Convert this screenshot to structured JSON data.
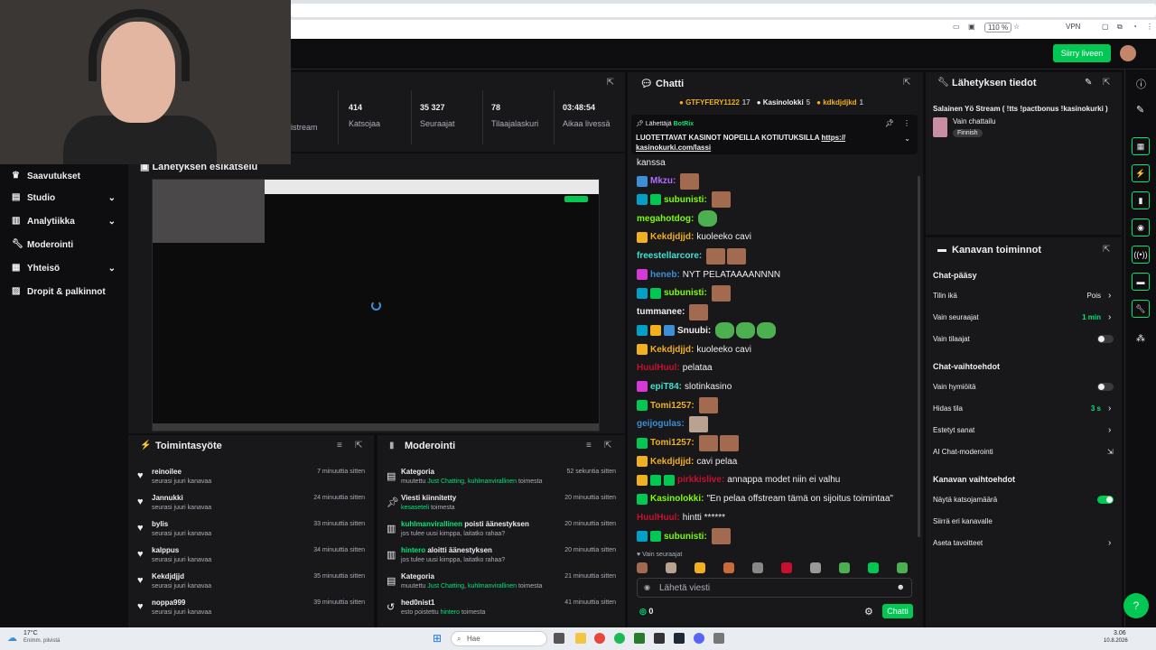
{
  "browser": {
    "zoom": "110 %",
    "vpn": "VPN"
  },
  "topbar": {
    "go_live": "Siirry liveen"
  },
  "nav": {
    "items": [
      {
        "label": "Saavutukset",
        "icon": "trophy-icon",
        "chev": false
      },
      {
        "label": "Studio",
        "icon": "studio-icon",
        "chev": true
      },
      {
        "label": "Analytiikka",
        "icon": "analytics-icon",
        "chev": true
      },
      {
        "label": "Moderointi",
        "icon": "wrench-icon",
        "chev": false
      },
      {
        "label": "Yhteisö",
        "icon": "community-icon",
        "chev": true
      },
      {
        "label": "Dropit & palkinnot",
        "icon": "gift-icon",
        "chev": false
      }
    ]
  },
  "stats": {
    "first_label": "istream",
    "items": [
      {
        "value": "414",
        "label": "Katsojaa"
      },
      {
        "value": "35 327",
        "label": "Seuraajat"
      },
      {
        "value": "78",
        "label": "Tilaajalaskuri"
      },
      {
        "value": "03:48:54",
        "label": "Aikaa livessä"
      }
    ]
  },
  "preview": {
    "title": "Lähetyksen esikatselu"
  },
  "activity": {
    "title": "Toimintasyöte",
    "items": [
      {
        "name": "reinoilee",
        "sub": "seurasi juuri kanavaa",
        "time": "7 minuuttia sitten"
      },
      {
        "name": "Jannukki",
        "sub": "seurasi juuri kanavaa",
        "time": "24 minuuttia sitten"
      },
      {
        "name": "bylis",
        "sub": "seurasi juuri kanavaa",
        "time": "33 minuuttia sitten"
      },
      {
        "name": "kalppus",
        "sub": "seurasi juuri kanavaa",
        "time": "34 minuuttia sitten"
      },
      {
        "name": "Kekdjdjjd",
        "sub": "seurasi juuri kanavaa",
        "time": "35 minuuttia sitten"
      },
      {
        "name": "noppa999",
        "sub": "seurasi juuri kanavaa",
        "time": "39 minuuttia sitten"
      }
    ]
  },
  "moderation": {
    "title": "Moderointi",
    "items": [
      {
        "name": "Kategoria",
        "pre": "muutettu ",
        "g1": "Just Chatting",
        "mid": ", ",
        "g2": "kuhlmanvirallinen",
        "post": " toimesta",
        "time": "52 sekuntia sitten",
        "icon": "category-icon"
      },
      {
        "name": "Viesti kiinnitetty",
        "pre": "",
        "g1": "kesaseteli",
        "mid": " toimesta",
        "g2": "",
        "post": "",
        "time": "20 minuuttia sitten",
        "icon": "pin-icon"
      },
      {
        "name_g": "kuhlmanvirallinen",
        "name": " poisti äänestyksen",
        "pre": "jos tulee uusi kimppa, laitatko rahaa?",
        "g1": "",
        "mid": "",
        "g2": "",
        "post": "",
        "time": "20 minuuttia sitten",
        "icon": "poll-icon"
      },
      {
        "name_g": "hintero",
        "name": " aloitti äänestyksen",
        "pre": "jos tulee uusi kimppa, laitatko rahaa?",
        "g1": "",
        "mid": "",
        "g2": "",
        "post": "",
        "time": "20 minuuttia sitten",
        "icon": "poll-icon"
      },
      {
        "name": "Kategoria",
        "pre": "muutettu ",
        "g1": "Just Chatting",
        "mid": ", ",
        "g2": "kuhlmanvirallinen",
        "post": " toimesta",
        "time": "21 minuuttia sitten",
        "icon": "category-icon"
      },
      {
        "name": "hed0nist1",
        "pre": "esto poistettu ",
        "g1": "hintero",
        "mid": " toimesta",
        "g2": "",
        "post": "",
        "time": "41 minuuttia sitten",
        "icon": "unban-icon"
      }
    ]
  },
  "chat": {
    "title": "Chatti",
    "gifters": [
      {
        "name": "GTFYFERY1122",
        "count": "17",
        "color": "#f0b020"
      },
      {
        "name": "Kasinolokki",
        "count": "5",
        "color": "#efeff1"
      },
      {
        "name": "kdkdjdjkd",
        "count": "1",
        "color": "#f0b020"
      }
    ],
    "pinned": {
      "sender_label": "Lähettäjä",
      "sender": "BotRix",
      "text": "LUOTETTAVAT KASINOT NOPEILLA KOTIUTUKSILLA",
      "link": "https://",
      "link2": "kasinokurki.com/lassi"
    },
    "messages": [
      {
        "user": "",
        "text": "kanssa",
        "color": "#efeff1",
        "badges": [],
        "emotes": 0
      },
      {
        "user": "Mkzu:",
        "text": "",
        "color": "#b26cff",
        "badges": [
          "#3a8fd6"
        ],
        "emotes": 1
      },
      {
        "user": "subunisti:",
        "text": "",
        "color": "#7cfc00",
        "badges": [
          "#00a0c8",
          "#00c853"
        ],
        "emotes": 1
      },
      {
        "user": "megahotdog:",
        "text": "",
        "color": "#7cfc00",
        "badges": [],
        "emotes": 1,
        "pepe": true
      },
      {
        "user": "Kekdjdjjd:",
        "text": "kuoleeko cavi",
        "color": "#f0b020",
        "badges": [
          "#f0b020"
        ],
        "emotes": 0
      },
      {
        "user": "freestellarcore:",
        "text": "",
        "color": "#40e0d0",
        "badges": [],
        "emotes": 2
      },
      {
        "user": "heneb:",
        "text": "NYT PELATAAAANNNN",
        "color": "#3a8fd6",
        "badges": [
          "#d63ad6"
        ],
        "emotes": 0
      },
      {
        "user": "subunisti:",
        "text": "",
        "color": "#7cfc00",
        "badges": [
          "#00a0c8",
          "#00c853"
        ],
        "emotes": 1
      },
      {
        "user": "tummanee:",
        "text": "",
        "color": "#efeff1",
        "badges": [],
        "emotes": 1
      },
      {
        "user": "Snuubi:",
        "text": "",
        "color": "#efeff1",
        "badges": [
          "#00a0c8",
          "#f0b020",
          "#3a8fd6"
        ],
        "emotes": 3,
        "pepe": true
      },
      {
        "user": "Kekdjdjjd:",
        "text": "kuoleeko cavi",
        "color": "#f0b020",
        "badges": [
          "#f0b020"
        ],
        "emotes": 0
      },
      {
        "user": "HuulHuul:",
        "text": "pelataa",
        "color": "#c8102e",
        "badges": [],
        "emotes": 0
      },
      {
        "user": "epiT84:",
        "text": "slotinkasino",
        "color": "#40e0d0",
        "badges": [
          "#d63ad6"
        ],
        "emotes": 0
      },
      {
        "user": "Tomi1257:",
        "text": "",
        "color": "#f0b020",
        "badges": [
          "#00c853"
        ],
        "emotes": 1
      },
      {
        "user": "geijogulas:",
        "text": "",
        "color": "#3a8fd6",
        "badges": [],
        "emotes": 1,
        "cat": true
      },
      {
        "user": "Tomi1257:",
        "text": "",
        "color": "#f0b020",
        "badges": [
          "#00c853"
        ],
        "emotes": 2
      },
      {
        "user": "Kekdjdjjd:",
        "text": "cavi pelaa",
        "color": "#f0b020",
        "badges": [
          "#f0b020"
        ],
        "emotes": 0
      },
      {
        "user": "pirkkislive:",
        "text": "annappa modet niin ei valhu",
        "color": "#c8102e",
        "badges": [
          "#f0b020",
          "#00c853",
          "#00c853"
        ],
        "emotes": 0
      },
      {
        "user": "Kasinolokki:",
        "text": "\"En pelaa offstream tämä on sijoitus toimintaa\"",
        "color": "#7cfc00",
        "badges": [
          "#00c853"
        ],
        "emotes": 0
      },
      {
        "user": "HuulHuul:",
        "text": "hintti ******",
        "color": "#c8102e",
        "badges": [],
        "emotes": 0
      },
      {
        "user": "subunisti:",
        "text": "",
        "color": "#7cfc00",
        "badges": [
          "#00a0c8",
          "#00c853"
        ],
        "emotes": 1
      }
    ],
    "followers_only": "Vain seuraajat",
    "input_placeholder": "Lähetä viesti",
    "points": "0",
    "send": "Chatti"
  },
  "stream_info": {
    "title": "Lähetyksen tiedot",
    "stream_title": "Salainen Yö Stream ( !tts !pactbonus !kasinokurki )",
    "category": "Vain chattailu",
    "tag": "Finnish"
  },
  "channel_actions": {
    "title": "Kanavan toiminnot",
    "sections": [
      {
        "heading": "Chat-pääsy",
        "rows": [
          {
            "label": "Tilin ikä",
            "value": "Pois",
            "green": false,
            "chev": true,
            "toggle": null
          },
          {
            "label": "Vain seuraajat",
            "value": "1 min",
            "green": true,
            "chev": true,
            "toggle": null
          },
          {
            "label": "Vain tilaajat",
            "value": "",
            "green": false,
            "chev": false,
            "toggle": false
          }
        ]
      },
      {
        "heading": "Chat-vaihtoehdot",
        "rows": [
          {
            "label": "Vain hymiöitä",
            "value": "",
            "green": false,
            "chev": false,
            "toggle": false
          },
          {
            "label": "Hidas tila",
            "value": "3 s",
            "green": true,
            "chev": true,
            "toggle": null
          },
          {
            "label": "Estetyt sanat",
            "value": "",
            "green": false,
            "chev": true,
            "toggle": null
          },
          {
            "label": "AI Chat-moderointi",
            "value": "",
            "green": false,
            "chev": false,
            "toggle": null,
            "ext": true
          }
        ]
      },
      {
        "heading": "Kanavan vaihtoehdot",
        "rows": [
          {
            "label": "Näytä katsojamäärä",
            "value": "",
            "green": false,
            "chev": false,
            "toggle": true
          },
          {
            "label": "Siirrä eri kanavalle",
            "value": "",
            "green": false,
            "chev": false,
            "toggle": null
          },
          {
            "label": "Aseta tavoitteet",
            "value": "",
            "green": false,
            "chev": true,
            "toggle": null
          }
        ]
      }
    ]
  },
  "taskbar": {
    "weather_temp": "17°C",
    "weather_desc": "Enimm. pilvistä",
    "search": "Hae",
    "time": "3.06",
    "date": "10.8.2026"
  }
}
